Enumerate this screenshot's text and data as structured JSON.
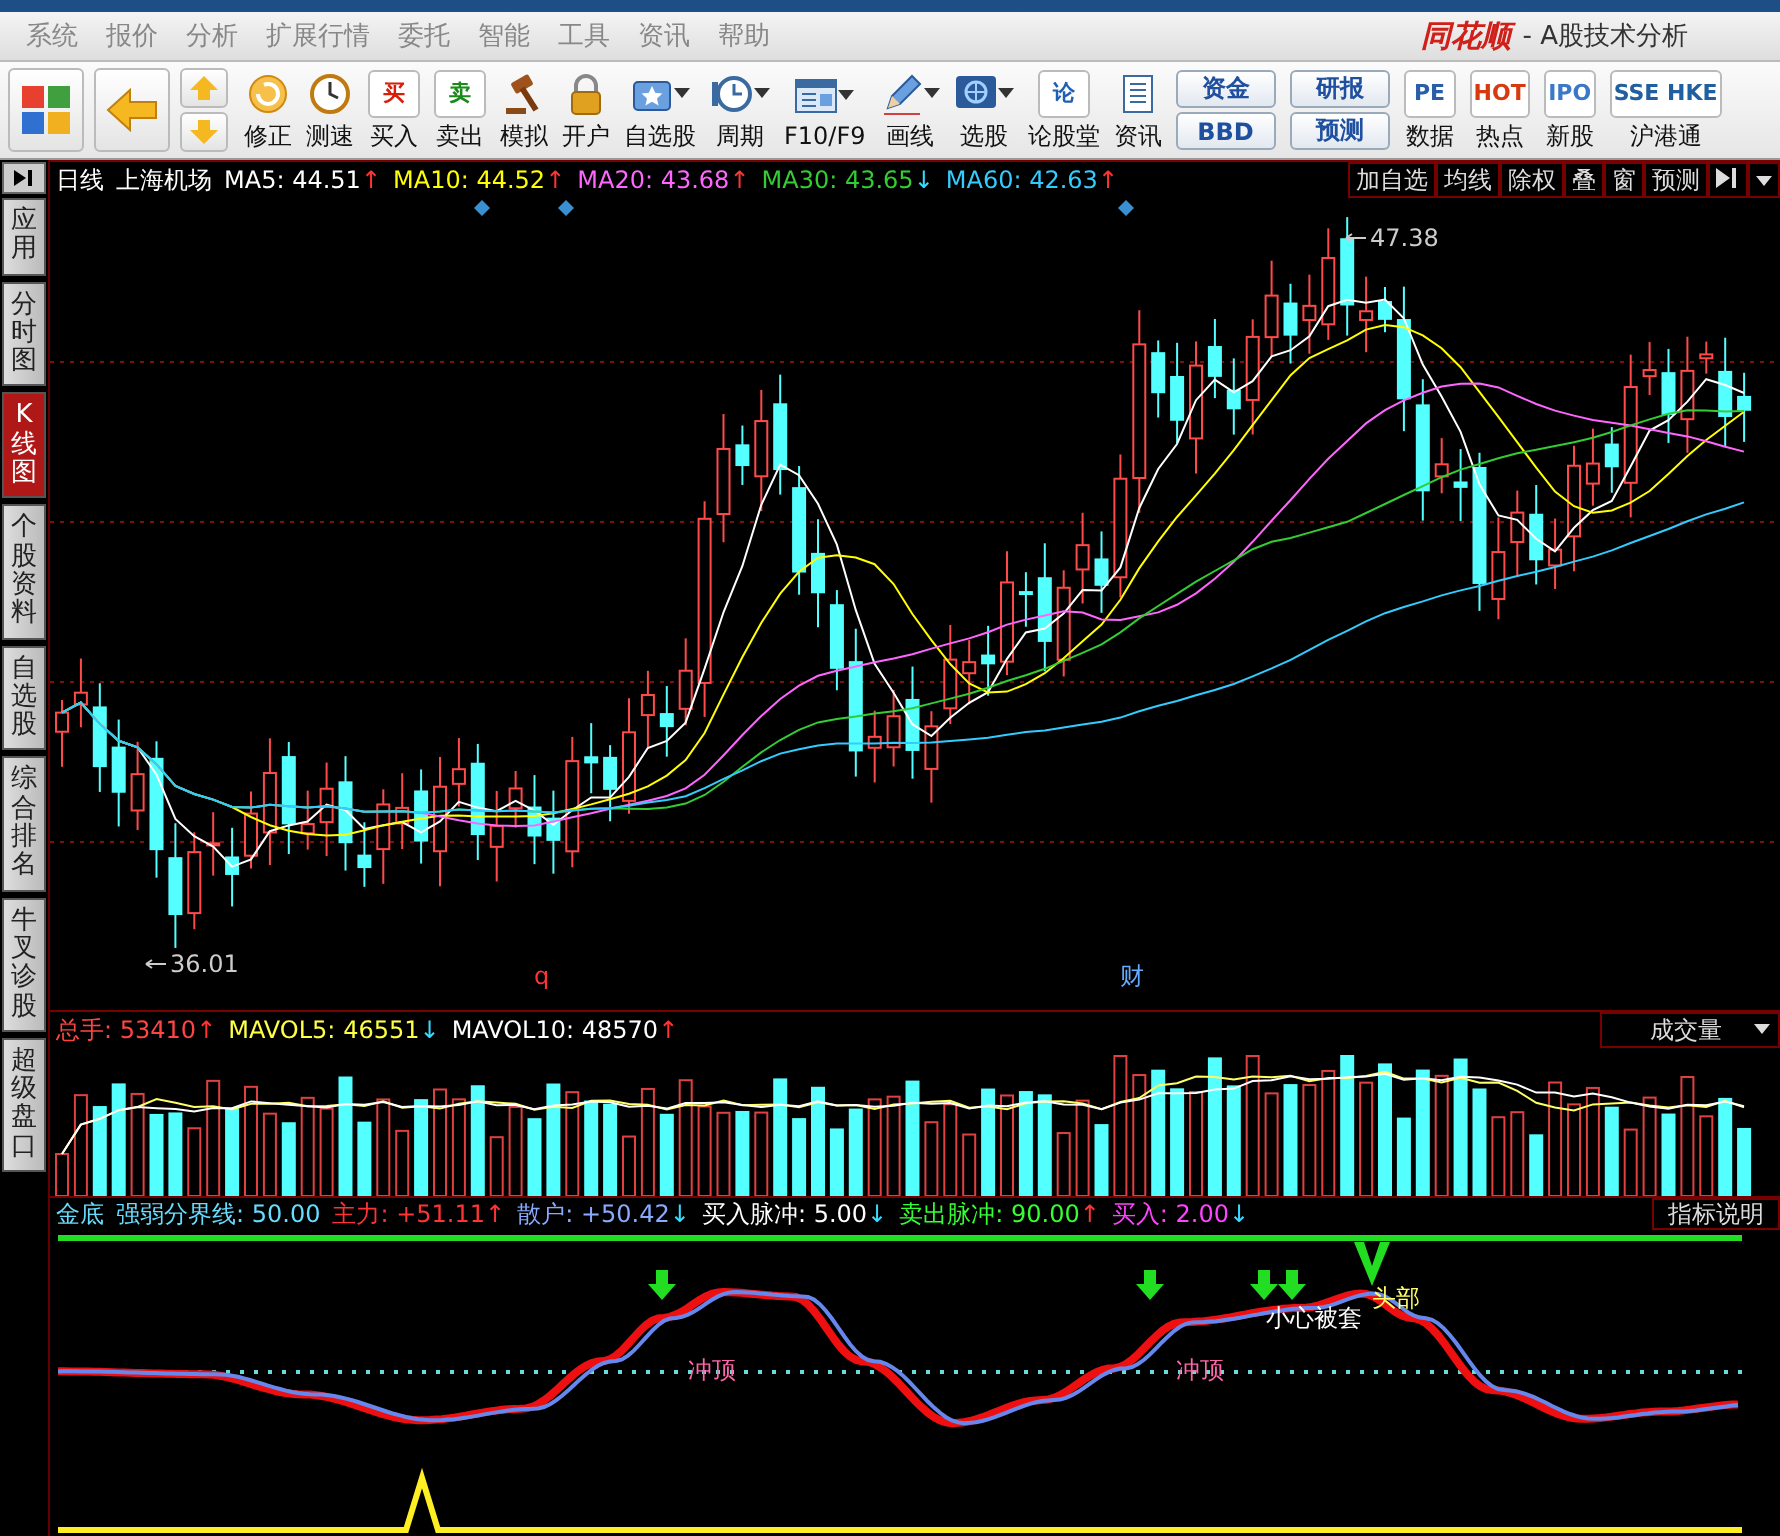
{
  "title_bar": {
    "logo": "同花顺",
    "title": "- A股技术分析"
  },
  "menu": [
    "系统",
    "报价",
    "分析",
    "扩展行情",
    "委托",
    "智能",
    "工具",
    "资讯",
    "帮助"
  ],
  "toolbar": [
    {
      "kind": "button",
      "label": "修正",
      "dropdown": false
    },
    {
      "kind": "button",
      "label": "测速",
      "dropdown": false
    },
    {
      "kind": "button",
      "label": "买入",
      "glyph": "买",
      "color": "#d81e06",
      "dropdown": false
    },
    {
      "kind": "button",
      "label": "卖出",
      "glyph": "卖",
      "color": "#1a8a1a",
      "dropdown": false
    },
    {
      "kind": "button",
      "label": "模拟",
      "dropdown": false
    },
    {
      "kind": "button",
      "label": "开户",
      "dropdown": false
    },
    {
      "kind": "button",
      "label": "自选股",
      "dropdown": true
    },
    {
      "kind": "button",
      "label": "周期",
      "dropdown": true
    },
    {
      "kind": "button",
      "label": "F10/F9",
      "dropdown": true
    },
    {
      "kind": "button",
      "label": "画线",
      "dropdown": true
    },
    {
      "kind": "button",
      "label": "选股",
      "dropdown": true
    },
    {
      "kind": "button",
      "label": "论股堂",
      "glyph": "论",
      "color": "#1f5fb4",
      "dropdown": false
    },
    {
      "kind": "button",
      "label": "资讯",
      "dropdown": false
    },
    {
      "kind": "pair",
      "labels": [
        "资金",
        "BBD"
      ]
    },
    {
      "kind": "pair",
      "labels": [
        "研报",
        "预测"
      ]
    },
    {
      "kind": "button",
      "label": "数据",
      "glyph": "PE",
      "color": "#2a5fa8",
      "dropdown": false
    },
    {
      "kind": "button",
      "label": "热点",
      "glyph": "HOT",
      "color": "#d83a10",
      "dropdown": false
    },
    {
      "kind": "button",
      "label": "新股",
      "glyph": "IPO",
      "color": "#3a78c8",
      "dropdown": false
    },
    {
      "kind": "button",
      "label": "沪港通",
      "glyph": "SSE HKE",
      "color": "#2060a0",
      "dropdown": false
    }
  ],
  "side_tabs": [
    {
      "label": "应用",
      "selected": false
    },
    {
      "label": "分时图",
      "selected": false
    },
    {
      "label": "K线图",
      "selected": true
    },
    {
      "label": "个股资料",
      "selected": false
    },
    {
      "label": "自选股",
      "selected": false
    },
    {
      "label": "综合排名",
      "selected": false
    },
    {
      "label": "牛叉诊股",
      "selected": false
    },
    {
      "label": "超级盘口",
      "selected": false
    }
  ],
  "chart_header": {
    "period": "日线",
    "stock": "上海机场",
    "indicators": [
      {
        "label": "MA5:",
        "value": "44.51",
        "arrow": "↑",
        "rising": true,
        "color": "#ffffff"
      },
      {
        "label": "MA10:",
        "value": "44.52",
        "arrow": "↑",
        "rising": true,
        "color": "#ffff00"
      },
      {
        "label": "MA20:",
        "value": "43.68",
        "arrow": "↑",
        "rising": true,
        "color": "#ff66ff"
      },
      {
        "label": "MA30:",
        "value": "43.65",
        "arrow": "↓",
        "rising": false,
        "color": "#33cc33"
      },
      {
        "label": "MA60:",
        "value": "42.63",
        "arrow": "↑",
        "rising": true,
        "color": "#33ccff"
      }
    ],
    "buttons": [
      "加自选",
      "均线",
      "除权",
      "叠",
      "窗",
      "预测"
    ]
  },
  "price_chart": {
    "high_label": "47.38",
    "low_label": "36.01",
    "markers": [
      {
        "text": "q",
        "color": "#ff3333"
      },
      {
        "text": "财",
        "color": "#66aaff"
      }
    ]
  },
  "volume_header": {
    "indicators": [
      {
        "label": "总手:",
        "value": "53410",
        "arrow": "↑",
        "rising": true,
        "color": "#ff4444"
      },
      {
        "label": "MAVOL5:",
        "value": "46551",
        "arrow": "↓",
        "rising": false,
        "color": "#ffff44"
      },
      {
        "label": "MAVOL10:",
        "value": "48570",
        "arrow": "↑",
        "rising": true,
        "color": "#ffffff"
      }
    ],
    "dropdown": "成交量"
  },
  "indicator_header": {
    "name": "金底",
    "indicators": [
      {
        "label": "强弱分界线:",
        "value": "50.00",
        "color": "#66ddff"
      },
      {
        "label": "主力:",
        "value": "+51.11",
        "arrow": "↑",
        "rising": true,
        "color": "#ff3333"
      },
      {
        "label": "散户:",
        "value": "+50.42",
        "arrow": "↓",
        "rising": false,
        "color": "#88aaff"
      },
      {
        "label": "买入脉冲:",
        "value": "5.00",
        "arrow": "↓",
        "rising": false,
        "color": "#ffffff"
      },
      {
        "label": "卖出脉冲:",
        "value": "90.00",
        "arrow": "↑",
        "rising": true,
        "color": "#33ff33"
      },
      {
        "label": "买入:",
        "value": "2.00",
        "arrow": "↓",
        "rising": false,
        "color": "#ff44ff"
      }
    ],
    "button": "指标说明"
  },
  "indicator_chart": {
    "labels": [
      {
        "text": "冲顶",
        "color": "#ff66aa"
      },
      {
        "text": "冲顶",
        "color": "#ff66aa"
      },
      {
        "text": "小心被套",
        "color": "#ffffff"
      },
      {
        "text": "头部",
        "color": "#ffff66"
      }
    ]
  }
}
